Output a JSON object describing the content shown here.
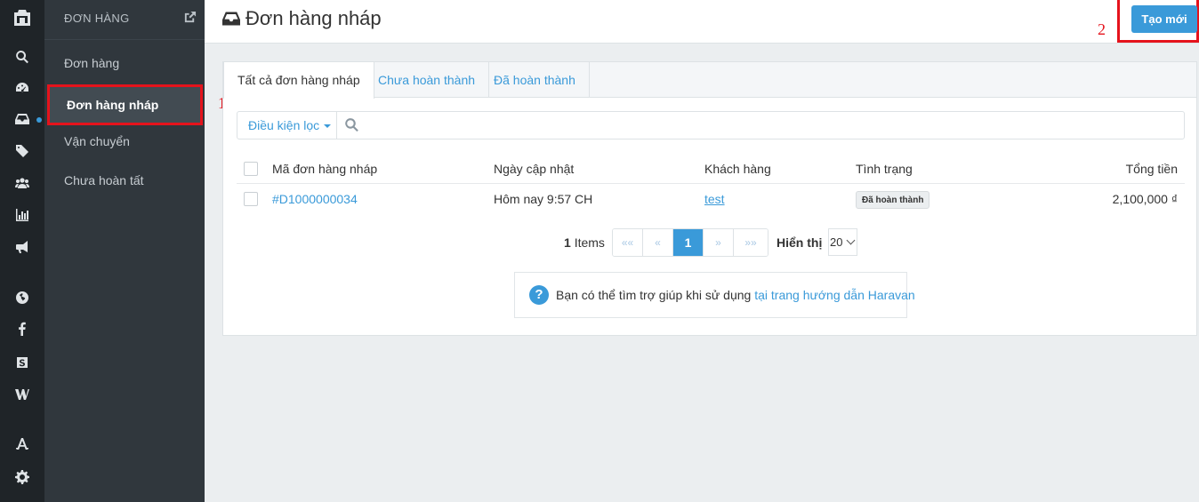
{
  "rail": {
    "icons": [
      "logo-icon",
      "search-icon",
      "dashboard-icon",
      "inbox-icon",
      "tag-icon",
      "users-icon",
      "bar-chart-icon",
      "megaphone-icon",
      "globe-icon",
      "facebook-icon",
      "store-icon",
      "w-icon",
      "apps-icon",
      "gear-icon"
    ]
  },
  "sidebar": {
    "header": "ĐƠN HÀNG",
    "items": [
      {
        "label": "Đơn hàng"
      },
      {
        "label": "Đơn hàng nháp"
      },
      {
        "label": "Vận chuyển"
      },
      {
        "label": "Chưa hoàn tất"
      }
    ]
  },
  "header": {
    "title": "Đơn hàng nháp",
    "create_label": "Tạo mới"
  },
  "annotations": {
    "one": "1",
    "two": "2"
  },
  "tabs": [
    {
      "label": "Tất cả đơn hàng nháp"
    },
    {
      "label": "Chưa hoàn thành"
    },
    {
      "label": "Đã hoàn thành"
    }
  ],
  "filter": {
    "label": "Điều kiện lọc",
    "placeholder": ""
  },
  "table": {
    "columns": [
      "Mã đơn hàng nháp",
      "Ngày cập nhật",
      "Khách hàng",
      "Tình trạng",
      "Tổng tiền"
    ],
    "rows": [
      {
        "code": "#D1000000034",
        "updated": "Hôm nay 9:57 CH",
        "customer": "test",
        "status": "Đã hoàn thành",
        "total": "2,100,000 ₫"
      }
    ]
  },
  "pagination": {
    "count": "1",
    "items_label": "Items",
    "first": "««",
    "prev": "«",
    "current": "1",
    "next": "»",
    "last": "»»",
    "show_label": "Hiển thị",
    "per_page": "20"
  },
  "help": {
    "text": "Bạn có thể tìm trợ giúp khi sử dụng",
    "link": "tại trang hướng dẫn Haravan",
    "icon": "?"
  },
  "colors": {
    "accent": "#3a9ad9",
    "highlight": "#e5131c",
    "rail_bg": "#1f2428",
    "sidebar_bg": "#30373d"
  }
}
